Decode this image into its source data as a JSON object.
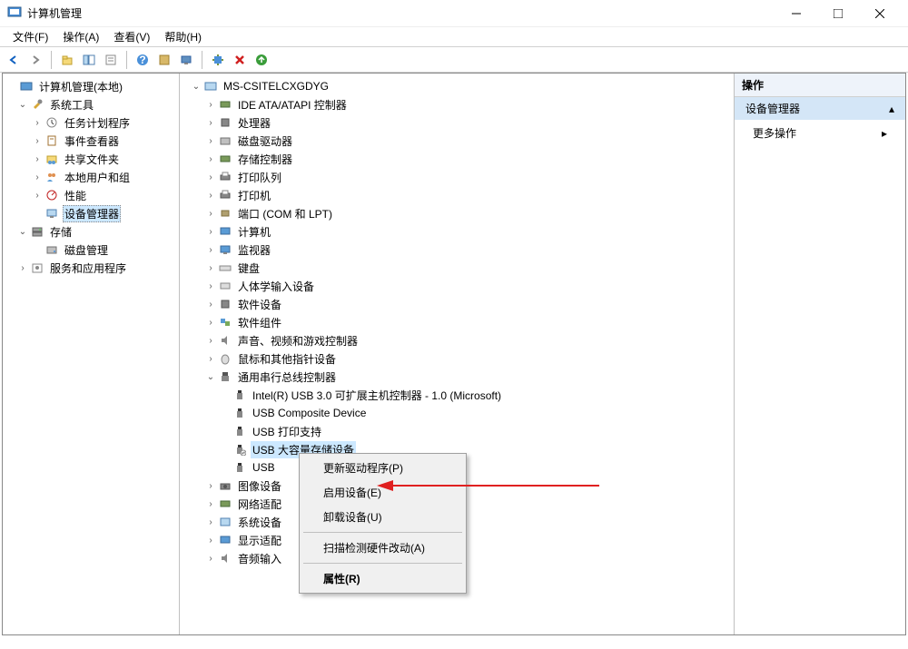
{
  "window": {
    "title": "计算机管理"
  },
  "menubar": {
    "file": "文件(F)",
    "action": "操作(A)",
    "view": "查看(V)",
    "help": "帮助(H)"
  },
  "leftTree": {
    "root": "计算机管理(本地)",
    "systemTools": "系统工具",
    "taskScheduler": "任务计划程序",
    "eventViewer": "事件查看器",
    "sharedFolders": "共享文件夹",
    "localUsersGroups": "本地用户和组",
    "performance": "性能",
    "deviceManager": "设备管理器",
    "storage": "存储",
    "diskManagement": "磁盘管理",
    "servicesApps": "服务和应用程序"
  },
  "deviceTree": {
    "root": "MS-CSITELCXGDYG",
    "ideAta": "IDE ATA/ATAPI 控制器",
    "processors": "处理器",
    "diskDrives": "磁盘驱动器",
    "storageControllers": "存储控制器",
    "printQueues": "打印队列",
    "printers": "打印机",
    "ports": "端口 (COM 和 LPT)",
    "computer": "计算机",
    "monitors": "监视器",
    "keyboards": "键盘",
    "hid": "人体学输入设备",
    "softwareDevices": "软件设备",
    "softwareComponents": "软件组件",
    "soundVideo": "声音、视频和游戏控制器",
    "mice": "鼠标和其他指针设备",
    "usbControllers": "通用串行总线控制器",
    "usbIntel": "Intel(R) USB 3.0 可扩展主机控制器 - 1.0 (Microsoft)",
    "usbComposite": "USB Composite Device",
    "usbPrintSupport": "USB 打印支持",
    "usbMassStorage": "USB 大容量存储设备",
    "usbPartial": "USB",
    "imagingDevices": "图像设备",
    "networkAdapters": "网络适配",
    "systemDevices": "系统设备",
    "displayAdapters": "显示适配",
    "audioInputs": "音频输入"
  },
  "rightPanel": {
    "header": "操作",
    "section": "设备管理器",
    "moreActions": "更多操作"
  },
  "contextMenu": {
    "updateDriver": "更新驱动程序(P)",
    "enableDevice": "启用设备(E)",
    "uninstallDevice": "卸载设备(U)",
    "scanHardware": "扫描检测硬件改动(A)",
    "properties": "属性(R)"
  }
}
